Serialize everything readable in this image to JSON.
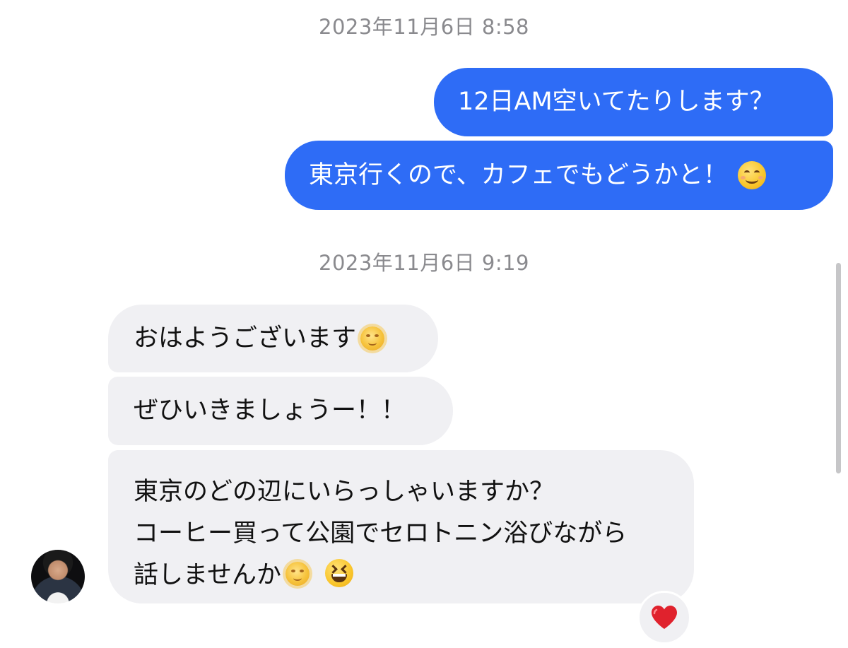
{
  "conversation": {
    "timestamps": [
      "2023年11月6日 8:58",
      "2023年11月6日 9:19"
    ],
    "outgoing": [
      {
        "text": "12日AM空いてたりします？"
      },
      {
        "text": "東京行くので、カフェでもどうかと！",
        "emoji": "smiling-face-icon"
      }
    ],
    "incoming": [
      {
        "text": "おはようございます",
        "emoji": "sun-with-face-icon"
      },
      {
        "text": "ぜひいきましょうー！！"
      },
      {
        "lines": [
          "東京のどの辺にいらっしゃいますか？",
          "コーヒー買って公園でセロトニン浴びながら",
          "話しませんか"
        ],
        "emojis": [
          "sun-with-face-icon",
          "grinning-squinting-face-icon"
        ]
      }
    ],
    "reaction": {
      "icon": "red-heart-icon",
      "color": "#e0222d"
    }
  },
  "colors": {
    "outgoing_bubble": "#2e6cf6",
    "incoming_bubble": "#f0f0f3",
    "timestamp_text": "#8a8a8e"
  }
}
